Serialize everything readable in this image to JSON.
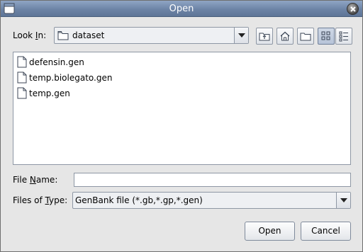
{
  "window": {
    "title": "Open"
  },
  "look_in": {
    "label": "Look In:",
    "mnemonic": "I",
    "label_pre": "Look ",
    "label_post": "n:",
    "value": "dataset"
  },
  "toolbar": {
    "buttons": [
      {
        "name": "up-one-level",
        "icon": "folder-up-icon"
      },
      {
        "name": "home",
        "icon": "home-icon"
      },
      {
        "name": "create-new-folder",
        "icon": "new-folder-icon"
      },
      {
        "name": "list-view",
        "icon": "list-view-icon",
        "active": true
      },
      {
        "name": "details-view",
        "icon": "details-view-icon",
        "active": false
      }
    ]
  },
  "files": [
    {
      "name": "defensin.gen"
    },
    {
      "name": "temp.biolegato.gen"
    },
    {
      "name": "temp.gen"
    }
  ],
  "file_name": {
    "label_pre": "File ",
    "mnemonic": "N",
    "label_post": "ame:",
    "value": ""
  },
  "files_of_type": {
    "label_pre": "Files of ",
    "mnemonic": "T",
    "label_post": "ype:",
    "value": "GenBank file (*.gb,*.gp,*.gen)"
  },
  "actions": {
    "open_label": "Open",
    "cancel_label": "Cancel"
  },
  "colors": {
    "titlebar": "#6d84a6",
    "window_bg": "#e6e6e6",
    "active_toggle": "#b7c4d8"
  }
}
